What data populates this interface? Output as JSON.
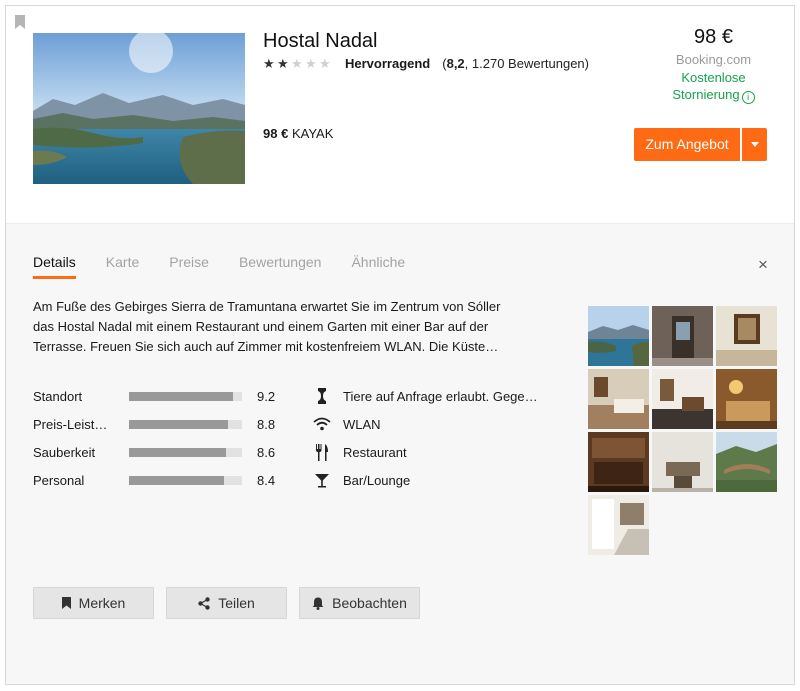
{
  "hotel": {
    "name": "Hostal Nadal",
    "stars_filled": 2,
    "stars_total": 5,
    "rating_word": "Hervorragend",
    "rating_score": "8,2",
    "rating_count": "1.270 Bewertungen",
    "alt_price": "98 €",
    "alt_provider": "KAYAK"
  },
  "price_box": {
    "price": "98 €",
    "provider": "Booking.com",
    "cancel_line1": "Kostenlose",
    "cancel_line2": "Stornierung",
    "info_icon": "i"
  },
  "offer_button": {
    "label": "Zum Angebot"
  },
  "tabs": [
    {
      "label": "Details"
    },
    {
      "label": "Karte"
    },
    {
      "label": "Preise"
    },
    {
      "label": "Bewertungen"
    },
    {
      "label": "Ähnliche"
    }
  ],
  "close_label": "×",
  "description_lines": [
    "Am Fuße des Gebirges Sierra de Tramuntana erwartet Sie im Zentrum von Sóller",
    "das Hostal Nadal mit einem Restaurant und einem Garten mit einer Bar auf der",
    "Terrasse. Freuen Sie sich auch auf Zimmer mit kostenfreiem WLAN. Die Küste…"
  ],
  "scores": [
    {
      "label": "Standort",
      "value": "9.2",
      "fraction": 0.92
    },
    {
      "label": "Preis-Leist…",
      "value": "8.8",
      "fraction": 0.88
    },
    {
      "label": "Sauberkeit",
      "value": "8.6",
      "fraction": 0.86
    },
    {
      "label": "Personal",
      "value": "8.4",
      "fraction": 0.84
    }
  ],
  "amenities": [
    {
      "icon": "pet-bone-icon",
      "label": "Tiere auf Anfrage erlaubt. Gege…"
    },
    {
      "icon": "wifi-icon",
      "label": "WLAN"
    },
    {
      "icon": "fork-knife-icon",
      "label": "Restaurant"
    },
    {
      "icon": "cocktail-icon",
      "label": "Bar/Lounge"
    }
  ],
  "actions": [
    {
      "icon": "bookmark-icon",
      "label": "Merken"
    },
    {
      "icon": "share-icon",
      "label": "Teilen"
    },
    {
      "icon": "bell-icon",
      "label": "Beobachten"
    }
  ],
  "colors": {
    "accent": "#ff6a14",
    "green": "#17a34a",
    "bar_fill": "#999999",
    "bar_track": "#e2e2e2"
  }
}
